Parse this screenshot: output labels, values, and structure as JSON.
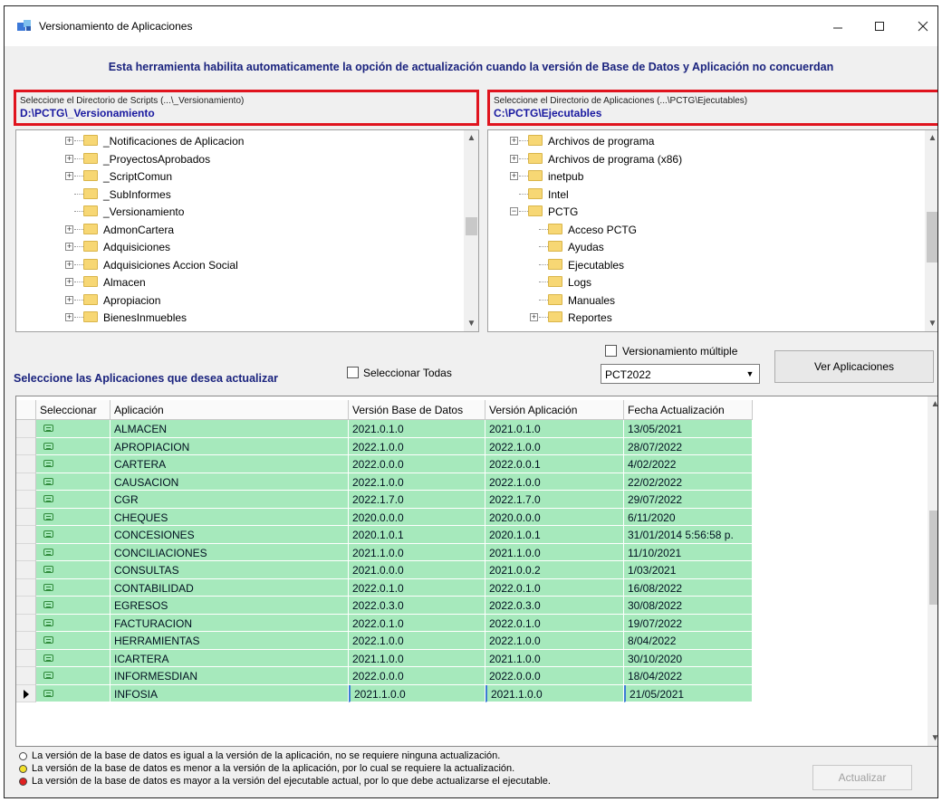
{
  "window": {
    "title": "Versionamiento de Aplicaciones",
    "banner": "Esta herramienta habilita automaticamente la opción de actualización cuando la versión de Base de Datos y Aplicación no concuerdan"
  },
  "scripts_dir": {
    "hint": "Seleccione el Directorio de Scripts (...\\_Versionamiento)",
    "path": "D:\\PCTG\\_Versionamiento",
    "tree": [
      {
        "label": "_Notificaciones de Aplicacion",
        "expandable": true
      },
      {
        "label": "_ProyectosAprobados",
        "expandable": true
      },
      {
        "label": "_ScriptComun",
        "expandable": true
      },
      {
        "label": "_SubInformes",
        "expandable": false
      },
      {
        "label": "_Versionamiento",
        "expandable": false
      },
      {
        "label": "AdmonCartera",
        "expandable": true
      },
      {
        "label": "Adquisiciones",
        "expandable": true
      },
      {
        "label": "Adquisiciones Accion Social",
        "expandable": true
      },
      {
        "label": "Almacen",
        "expandable": true
      },
      {
        "label": "Apropiacion",
        "expandable": true
      },
      {
        "label": "BienesInmuebles",
        "expandable": true
      }
    ]
  },
  "apps_dir": {
    "hint": "Seleccione el Directorio de Aplicaciones (...\\PCTG\\Ejecutables)",
    "path": "C:\\PCTG\\Ejecutables",
    "tree": [
      {
        "label": "Archivos de programa",
        "expandable": true,
        "level": 0
      },
      {
        "label": "Archivos de programa (x86)",
        "expandable": true,
        "level": 0
      },
      {
        "label": "inetpub",
        "expandable": true,
        "level": 0
      },
      {
        "label": "Intel",
        "expandable": false,
        "level": 0
      },
      {
        "label": "PCTG",
        "expandable": true,
        "expanded": true,
        "level": 0
      },
      {
        "label": "Acceso PCTG",
        "expandable": false,
        "level": 1
      },
      {
        "label": "Ayudas",
        "expandable": false,
        "level": 1
      },
      {
        "label": "Ejecutables",
        "expandable": false,
        "level": 1
      },
      {
        "label": "Logs",
        "expandable": false,
        "level": 1
      },
      {
        "label": "Manuales",
        "expandable": false,
        "level": 1
      },
      {
        "label": "Reportes",
        "expandable": true,
        "level": 1
      }
    ]
  },
  "controls": {
    "select_label": "Seleccione las Aplicaciones que desea actualizar",
    "select_all": "Seleccionar Todas",
    "multi_version": "Versionamiento múltiple",
    "combo_value": "PCT2022",
    "ver_button": "Ver Aplicaciones",
    "update_button": "Actualizar"
  },
  "grid": {
    "columns": [
      "Seleccionar",
      "Aplicación",
      "Versión Base de Datos",
      "Versión Aplicación",
      "Fecha Actualización"
    ],
    "rows": [
      [
        "ALMACEN",
        "2021.0.1.0",
        "2021.0.1.0",
        "13/05/2021"
      ],
      [
        "APROPIACION",
        "2022.1.0.0",
        "2022.1.0.0",
        "28/07/2022"
      ],
      [
        "CARTERA",
        "2022.0.0.0",
        "2022.0.0.1",
        "4/02/2022"
      ],
      [
        "CAUSACION",
        "2022.1.0.0",
        "2022.1.0.0",
        "22/02/2022"
      ],
      [
        "CGR",
        "2022.1.7.0",
        "2022.1.7.0",
        "29/07/2022"
      ],
      [
        "CHEQUES",
        "2020.0.0.0",
        "2020.0.0.0",
        "6/11/2020"
      ],
      [
        "CONCESIONES",
        "2020.1.0.1",
        "2020.1.0.1",
        "31/01/2014 5:56:58 p."
      ],
      [
        "CONCILIACIONES",
        "2021.1.0.0",
        "2021.1.0.0",
        "11/10/2021"
      ],
      [
        "CONSULTAS",
        "2021.0.0.0",
        "2021.0.0.2",
        "1/03/2021"
      ],
      [
        "CONTABILIDAD",
        "2022.0.1.0",
        "2022.0.1.0",
        "16/08/2022"
      ],
      [
        "EGRESOS",
        "2022.0.3.0",
        "2022.0.3.0",
        "30/08/2022"
      ],
      [
        "FACTURACION",
        "2022.0.1.0",
        "2022.0.1.0",
        "19/07/2022"
      ],
      [
        "HERRAMIENTAS",
        "2022.1.0.0",
        "2022.1.0.0",
        "8/04/2022"
      ],
      [
        "ICARTERA",
        "2021.1.0.0",
        "2021.1.0.0",
        "30/10/2020"
      ],
      [
        "INFORMESDIAN",
        "2022.0.0.0",
        "2022.0.0.0",
        "18/04/2022"
      ],
      [
        "INFOSIA",
        "2021.1.0.0",
        "2021.1.0.0",
        "21/05/2021"
      ]
    ],
    "current_row": 15
  },
  "legend": [
    {
      "color": "#ffffff",
      "text": "La versión de la base de datos es igual a la versión de la aplicación, no se requiere ninguna actualización."
    },
    {
      "color": "#f2e02a",
      "text": "La versión de la base de datos es menor a la versión de la aplicación, por lo cual se requiere la actualización."
    },
    {
      "color": "#e02020",
      "text": "La versión de la base de datos es mayor a la versión del ejecutable actual, por lo que debe actualizarse el ejecutable."
    }
  ],
  "colors": {
    "row_fill": "#a6e9bc",
    "banner_text": "#1a237e",
    "highlight_border": "#e0141e"
  }
}
